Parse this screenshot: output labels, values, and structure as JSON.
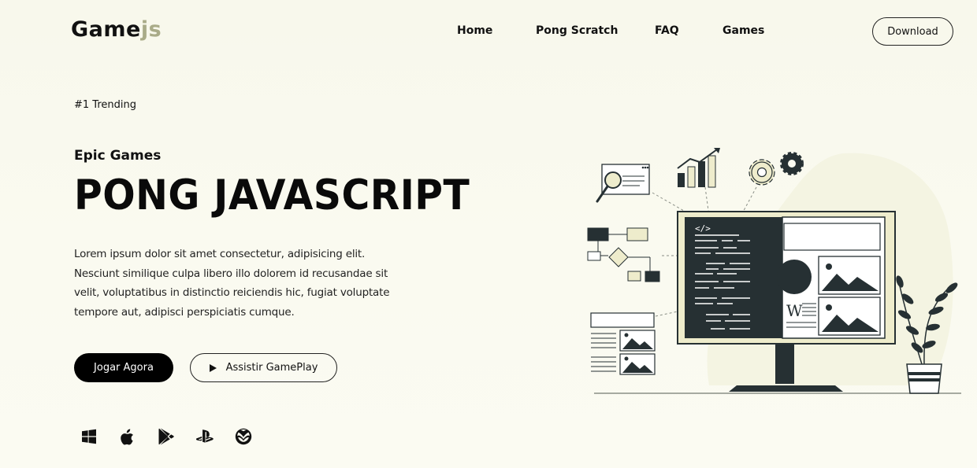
{
  "brand": {
    "name_main": "Game",
    "name_accent": "js",
    "accent_color": "#a9ab88"
  },
  "nav": {
    "items": [
      {
        "label": "Home"
      },
      {
        "label": "Pong Scratch"
      },
      {
        "label": "FAQ"
      },
      {
        "label": "Games"
      }
    ],
    "download_label": "Download"
  },
  "hero": {
    "badge": "#1 Trending",
    "subtitle": "Epic Games",
    "title": "PONG JAVASCRIPT",
    "description_lines": [
      "Lorem ipsum dolor sit amet consectetur, adipisicing elit.",
      "Nesciunt similique culpa libero illo dolorem id recusandae sit",
      "velit, voluptatibus in distinctio reiciendis hic, fugiat voluptate",
      "tempore aut, adipisci perspiciatis cumque."
    ],
    "primary_button": "Jogar Agora",
    "secondary_button": "Assistir GamePlay"
  },
  "platforms": [
    {
      "icon": "windows-icon"
    },
    {
      "icon": "apple-icon"
    },
    {
      "icon": "google-play-icon"
    },
    {
      "icon": "playstation-icon"
    },
    {
      "icon": "xbox-icon"
    }
  ],
  "illustration": {
    "code_tag": "</>",
    "doc_letter": "W",
    "colors": {
      "dark": "#263033",
      "cream": "#eeeccc",
      "line": "#8a8f86"
    }
  }
}
